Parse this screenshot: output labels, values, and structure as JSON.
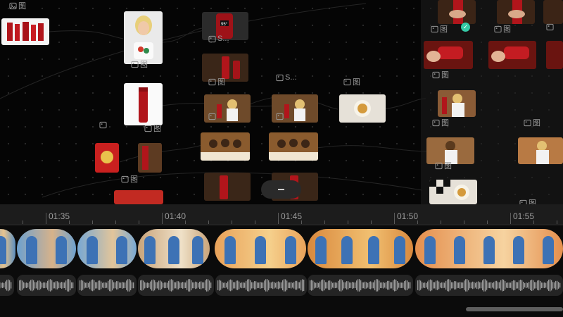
{
  "canvas": {
    "image_label": "图",
    "text_label_s": "S...",
    "text_label_s2": "S..."
  },
  "timeline": {
    "time_labels": [
      "01:35",
      "01:40",
      "01:45",
      "01:50",
      "01:55"
    ]
  },
  "colors": {
    "accent_check": "#35c9a6",
    "product_red": "#b1151b",
    "sunset": "#e9a25a",
    "panel_bg": "#1e1e1e"
  },
  "icons": [
    "image-icon",
    "checkmark-icon",
    "collapse-icon",
    "scrollbar"
  ]
}
